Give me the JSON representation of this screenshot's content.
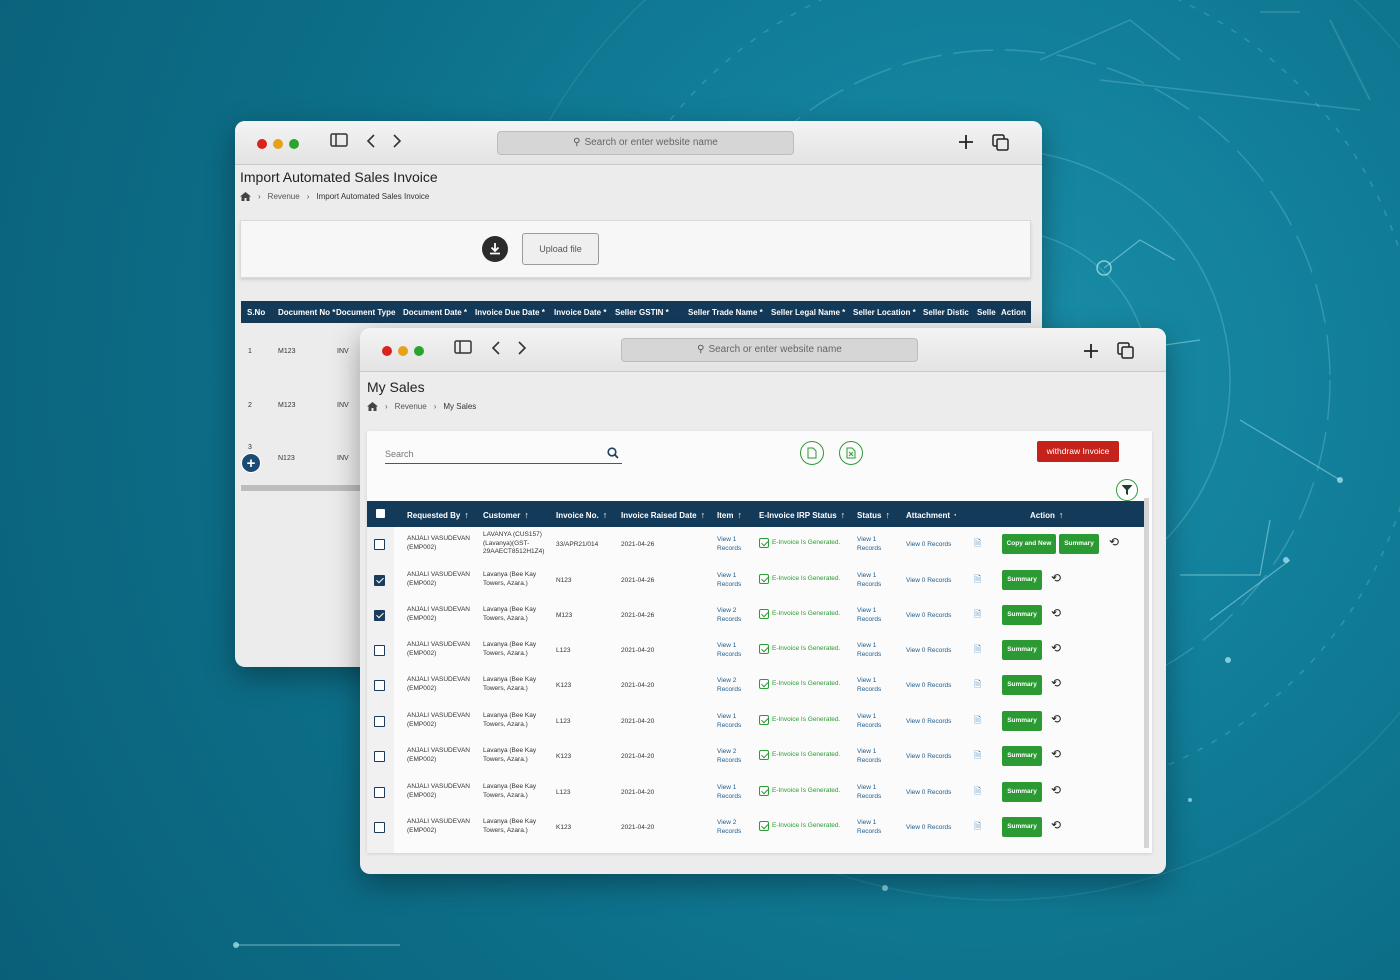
{
  "back_window": {
    "address_placeholder": "Search or enter website name",
    "page_title": "Import Automated Sales Invoice",
    "breadcrumb": [
      "Revenue",
      "Import Automated Sales Invoice"
    ],
    "upload_label": "Upload file",
    "table_headers": [
      "S.No",
      "Document No *",
      "Document Type",
      "Document Date *",
      "Invoice Due Date *",
      "Invoice Date *",
      "Seller GSTIN *",
      "Seller Trade Name *",
      "Seller Legal Name *",
      "Seller Location *",
      "Seller Distic",
      "Selle",
      "Action"
    ],
    "rows": [
      {
        "sno": "1",
        "doc_no": "M123",
        "doc_type": "INV"
      },
      {
        "sno": "2",
        "doc_no": "M123",
        "doc_type": "INV"
      },
      {
        "sno": "3",
        "doc_no": "N123",
        "doc_type": "INV"
      }
    ]
  },
  "front_window": {
    "address_placeholder": "Search or enter website name",
    "page_title": "My Sales",
    "breadcrumb": [
      "Revenue",
      "My Sales"
    ],
    "search_placeholder": "Search",
    "withdraw_label": "withdraw Invoice",
    "columns": [
      "Requested By",
      "Customer",
      "Invoice No.",
      "Invoice Raised Date",
      "Item",
      "E-Invoice IRP Status",
      "Status",
      "Attachment",
      "Action"
    ],
    "rows": [
      {
        "checked": false,
        "req1": "ANJALI VASUDEVAN",
        "req2": "(EMP002)",
        "cust1": "LAVANYA (CUS157)",
        "cust2": "(Lavanya)(GST-",
        "cust3": "29AAECT8512H1Z4)",
        "inv": "33/APR21/014",
        "date": "2021-04-26",
        "item1": "View 1",
        "item2": "Records",
        "irp": "E-Invoice Is Generated.",
        "st1": "View 1",
        "st2": "Records",
        "att": "View 0 Records",
        "copy_label": "Copy and New",
        "summary": "Summary"
      },
      {
        "checked": true,
        "req1": "ANJALI VASUDEVAN",
        "req2": "(EMP002)",
        "cust1": "Lavanya (Bee Kay",
        "cust2": "Towers, Azara.)",
        "cust3": "",
        "inv": "N123",
        "date": "2021-04-26",
        "item1": "View 1",
        "item2": "Records",
        "irp": "E-Invoice Is Generated.",
        "st1": "View 1",
        "st2": "Records",
        "att": "View 0 Records",
        "summary": "Summary"
      },
      {
        "checked": true,
        "req1": "ANJALI VASUDEVAN",
        "req2": "(EMP002)",
        "cust1": "Lavanya (Bee Kay",
        "cust2": "Towers, Azara.)",
        "cust3": "",
        "inv": "M123",
        "date": "2021-04-26",
        "item1": "View 2",
        "item2": "Records",
        "irp": "E-Invoice Is Generated.",
        "st1": "View 1",
        "st2": "Records",
        "att": "View 0 Records",
        "summary": "Summary"
      },
      {
        "checked": false,
        "req1": "ANJALI VASUDEVAN",
        "req2": "(EMP002)",
        "cust1": "Lavanya (Bee Kay",
        "cust2": "Towers, Azara.)",
        "cust3": "",
        "inv": "L123",
        "date": "2021-04-20",
        "item1": "View 1",
        "item2": "Records",
        "irp": "E-Invoice Is Generated.",
        "st1": "View 1",
        "st2": "Records",
        "att": "View 0 Records",
        "summary": "Summary"
      },
      {
        "checked": false,
        "req1": "ANJALI VASUDEVAN",
        "req2": "(EMP002)",
        "cust1": "Lavanya (Bee Kay",
        "cust2": "Towers, Azara.)",
        "cust3": "",
        "inv": "K123",
        "date": "2021-04-20",
        "item1": "View 2",
        "item2": "Records",
        "irp": "E-Invoice Is Generated.",
        "st1": "View 1",
        "st2": "Records",
        "att": "View 0 Records",
        "summary": "Summary"
      },
      {
        "checked": false,
        "req1": "ANJALI VASUDEVAN",
        "req2": "(EMP002)",
        "cust1": "Lavanya (Bee Kay",
        "cust2": "Towers, Azara.)",
        "cust3": "",
        "inv": "L123",
        "date": "2021-04-20",
        "item1": "View 1",
        "item2": "Records",
        "irp": "E-Invoice Is Generated.",
        "st1": "View 1",
        "st2": "Records",
        "att": "View 0 Records",
        "summary": "Summary"
      },
      {
        "checked": false,
        "req1": "ANJALI VASUDEVAN",
        "req2": "(EMP002)",
        "cust1": "Lavanya (Bee Kay",
        "cust2": "Towers, Azara.)",
        "cust3": "",
        "inv": "K123",
        "date": "2021-04-20",
        "item1": "View 2",
        "item2": "Records",
        "irp": "E-Invoice Is Generated.",
        "st1": "View 1",
        "st2": "Records",
        "att": "View 0 Records",
        "summary": "Summary"
      },
      {
        "checked": false,
        "req1": "ANJALI VASUDEVAN",
        "req2": "(EMP002)",
        "cust1": "Lavanya (Bee Kay",
        "cust2": "Towers, Azara.)",
        "cust3": "",
        "inv": "L123",
        "date": "2021-04-20",
        "item1": "View 1",
        "item2": "Records",
        "irp": "E-Invoice Is Generated.",
        "st1": "View 1",
        "st2": "Records",
        "att": "View 0 Records",
        "summary": "Summary"
      },
      {
        "checked": false,
        "req1": "ANJALI VASUDEVAN",
        "req2": "(EMP002)",
        "cust1": "Lavanya (Bee Kay",
        "cust2": "Towers, Azara.)",
        "cust3": "",
        "inv": "K123",
        "date": "2021-04-20",
        "item1": "View 2",
        "item2": "Records",
        "irp": "E-Invoice Is Generated.",
        "st1": "View 1",
        "st2": "Records",
        "att": "View 0 Records",
        "summary": "Summary"
      }
    ]
  },
  "colors": {
    "background": "#0f7791",
    "table_header": "#143a5a",
    "button_green": "#2b9a33",
    "button_red": "#c4221b",
    "status_green": "#2a9b35"
  }
}
